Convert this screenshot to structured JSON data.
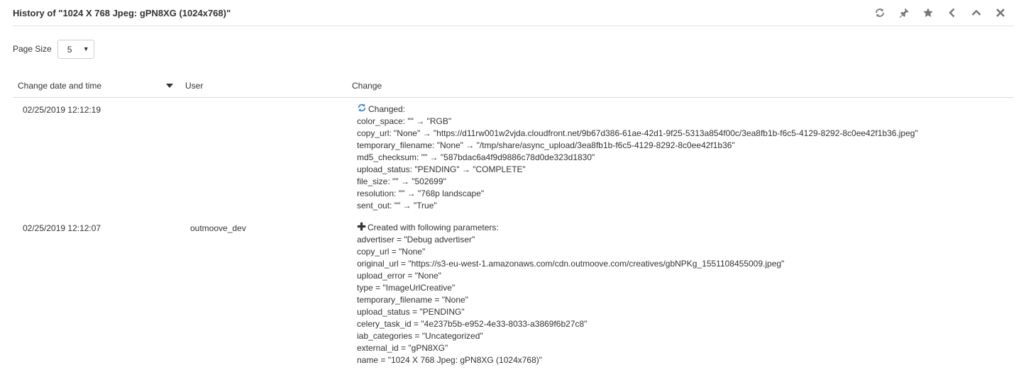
{
  "header": {
    "title": "History of \"1024 X 768 Jpeg: gPN8XG (1024x768)\"",
    "tools": [
      "refresh-icon",
      "pin-icon",
      "star-icon",
      "chevron-left-icon",
      "chevron-up-icon",
      "close-icon"
    ]
  },
  "page_size": {
    "label": "Page Size",
    "value": "5"
  },
  "table": {
    "columns": {
      "date": "Change date and time",
      "user": "User",
      "change": "Change"
    },
    "sort_direction": "descending",
    "rows": [
      {
        "date": "02/25/2019 12:12:19",
        "user": "",
        "change_icon": "refresh-icon",
        "change_heading": "Changed:",
        "lines": [
          "color_space: \"\" → \"RGB\"",
          "copy_url: \"None\" → \"https://d11rw001w2vjda.cloudfront.net/9b67d386-61ae-42d1-9f25-5313a854f00c/3ea8fb1b-f6c5-4129-8292-8c0ee42f1b36.jpeg\"",
          "temporary_filename: \"None\" → \"/tmp/share/async_upload/3ea8fb1b-f6c5-4129-8292-8c0ee42f1b36\"",
          "md5_checksum: \"\" → \"587bdac6a4f9d9886c78d0de323d1830\"",
          "upload_status: \"PENDING\" → \"COMPLETE\"",
          "file_size: \"\" → \"502699\"",
          "resolution: \"\" → \"768p landscape\"",
          "sent_out: \"\" → \"True\""
        ]
      },
      {
        "date": "02/25/2019 12:12:07",
        "user": "outmoove_dev",
        "change_icon": "plus-icon",
        "change_heading": "Created with following parameters:",
        "lines": [
          "advertiser = \"Debug advertiser\"",
          "copy_url = \"None\"",
          "original_url = \"https://s3-eu-west-1.amazonaws.com/cdn.outmoove.com/creatives/gbNPKg_1551108455009.jpeg\"",
          "upload_error = \"None\"",
          "type = \"ImageUrlCreative\"",
          "temporary_filename = \"None\"",
          "upload_status = \"PENDING\"",
          "celery_task_id = \"4e237b5b-e952-4e33-8033-a3869f6b27c8\"",
          "iab_categories = \"Uncategorized\"",
          "external_id = \"gPN8XG\"",
          "name = \"1024 X 768 Jpeg: gPN8XG (1024x768)\""
        ]
      }
    ]
  },
  "colors": {
    "text": "#333333",
    "icon": "#666666",
    "refresh_accent": "#3a87c8",
    "divider": "#d9d9d9"
  }
}
